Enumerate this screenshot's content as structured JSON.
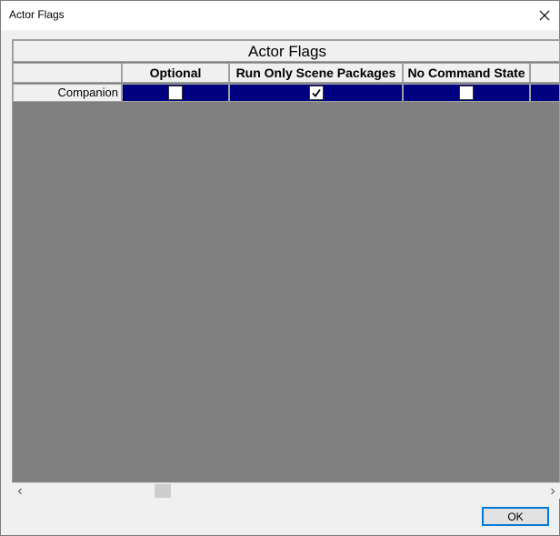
{
  "window": {
    "title": "Actor Flags"
  },
  "grid": {
    "title": "Actor Flags",
    "columns": [
      {
        "label": ""
      },
      {
        "label": "Optional"
      },
      {
        "label": "Run Only Scene Packages"
      },
      {
        "label": "No Command State"
      },
      {
        "label": ""
      }
    ],
    "rows": [
      {
        "label": "Companion",
        "values": [
          false,
          true,
          false
        ]
      }
    ]
  },
  "buttons": {
    "ok_label": "OK"
  },
  "colors": {
    "selected_row": "#000080",
    "grid_background": "#808080",
    "header_background": "#f0f0f0",
    "ok_border": "#0078d7"
  }
}
